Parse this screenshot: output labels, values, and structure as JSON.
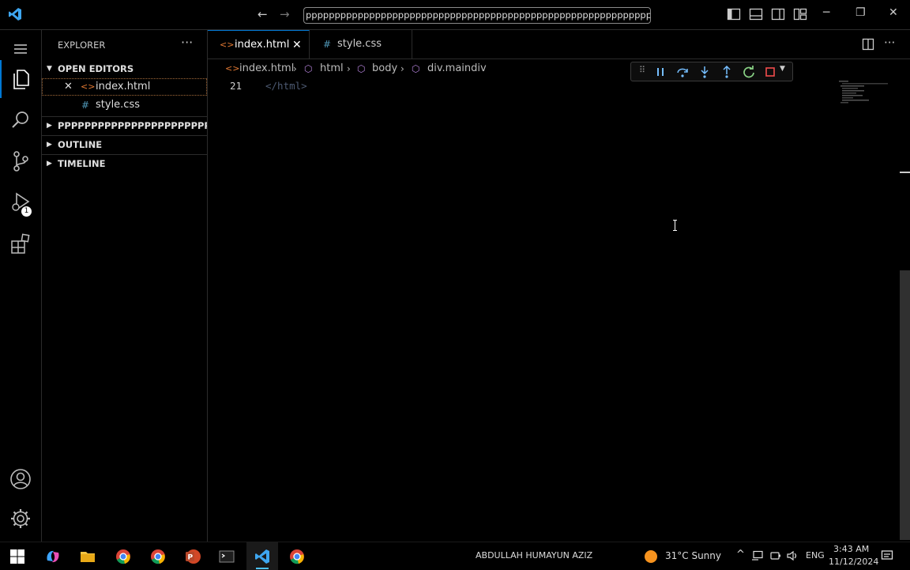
{
  "title_bar": {
    "nav_back": "←",
    "nav_forward": "→",
    "command_center_text": "ppppppppppppppppppppppppppppppppppppppppppppppppppppppppppppppp",
    "minimize": "─",
    "restore": "❐",
    "close": "✕"
  },
  "activity_bar": {
    "debug_badge": "1"
  },
  "sidebar": {
    "title": "EXPLORER",
    "more": "···",
    "open_editors_label": "OPEN EDITORS",
    "open_editors": [
      {
        "name": "index.html",
        "icon": "html-file-icon"
      },
      {
        "name": "style.css",
        "icon": "css-file-icon"
      }
    ],
    "folder_label": "PPPPPPPPPPPPPPPPPPPPPPPPPPPP...",
    "outline_label": "OUTLINE",
    "timeline_label": "TIMELINE"
  },
  "editor": {
    "tabs": [
      {
        "label": "index.html",
        "active": true
      },
      {
        "label": "style.css",
        "active": false
      }
    ],
    "breadcrumb": [
      "index.html",
      "html",
      "body",
      "div.maindiv"
    ],
    "line_number": "21",
    "line_code": "</html>"
  },
  "taskbar": {
    "user_name": "ABDULLAH HUMAYUN AZIZ",
    "weather": "31°C  Sunny",
    "language": "ENG",
    "time": "3:43 AM",
    "date": "11/12/2024"
  },
  "colors": {
    "accent": "#0078d4",
    "background": "#000000",
    "html_icon": "#e37933",
    "css_icon": "#519aba",
    "debug_green": "#89d185",
    "debug_red": "#f14c4c"
  }
}
